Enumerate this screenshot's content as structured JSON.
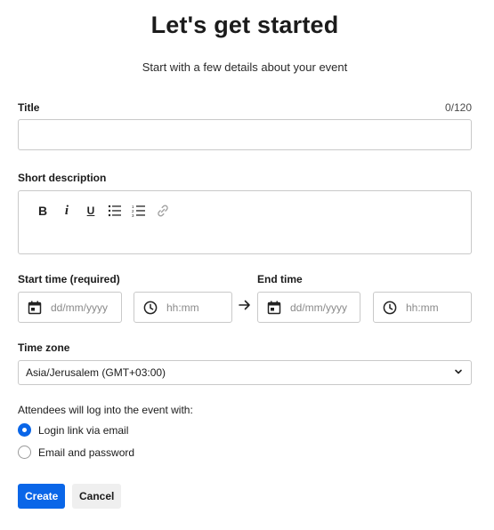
{
  "header": {
    "title": "Let's get started",
    "subtitle": "Start with a few details about your event"
  },
  "title_field": {
    "label": "Title",
    "counter": "0/120",
    "value": ""
  },
  "description_field": {
    "label": "Short description",
    "toolbar": [
      {
        "name": "bold",
        "glyph": "B"
      },
      {
        "name": "italic",
        "glyph": "i"
      },
      {
        "name": "underline",
        "glyph": "U"
      },
      {
        "name": "bullet-list-icon",
        "glyph": ""
      },
      {
        "name": "numbered-list-icon",
        "glyph": ""
      },
      {
        "name": "link-icon",
        "glyph": ""
      }
    ],
    "value": ""
  },
  "start_time": {
    "label": "Start time (required)",
    "date_placeholder": "dd/mm/yyyy",
    "time_placeholder": "hh:mm"
  },
  "end_time": {
    "label": "End time",
    "date_placeholder": "dd/mm/yyyy",
    "time_placeholder": "hh:mm"
  },
  "timezone": {
    "label": "Time zone",
    "selected": "Asia/Jerusalem (GMT+03:00)"
  },
  "login_method": {
    "label": "Attendees will log into the event with:",
    "options": [
      {
        "label": "Login link via email",
        "selected": true
      },
      {
        "label": "Email and password",
        "selected": false
      }
    ]
  },
  "actions": {
    "create_label": "Create",
    "cancel_label": "Cancel"
  },
  "colors": {
    "primary": "#0a66e8",
    "border": "#c9c9c9",
    "secondary_bg": "#efefef"
  }
}
